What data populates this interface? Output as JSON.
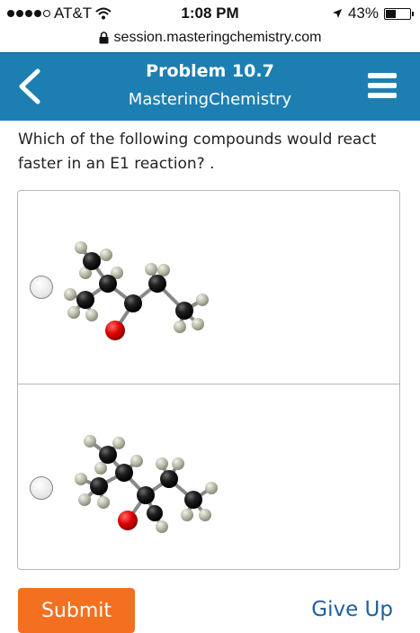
{
  "status_bar": {
    "carrier": "AT&T",
    "time": "1:08 PM",
    "battery": "43%",
    "battery_level": 0.43
  },
  "url_bar": {
    "url": "session.masteringchemistry.com"
  },
  "header": {
    "title": "Problem 10.7",
    "subtitle": "MasteringChemistry",
    "background": "#1d7fb1"
  },
  "question": {
    "text": "Which of the following compounds would react faster in an E1 reaction? ."
  },
  "options": [
    {
      "selected": false
    },
    {
      "selected": false
    }
  ],
  "actions": {
    "submit_label": "Submit",
    "giveup_label": "Give Up",
    "submit_color": "#f37021"
  },
  "icons": {
    "back": "chevron-left-icon",
    "menu": "hamburger-menu-icon",
    "lock": "lock-icon",
    "wifi": "wifi-icon",
    "location": "location-arrow-icon",
    "battery": "battery-icon"
  }
}
